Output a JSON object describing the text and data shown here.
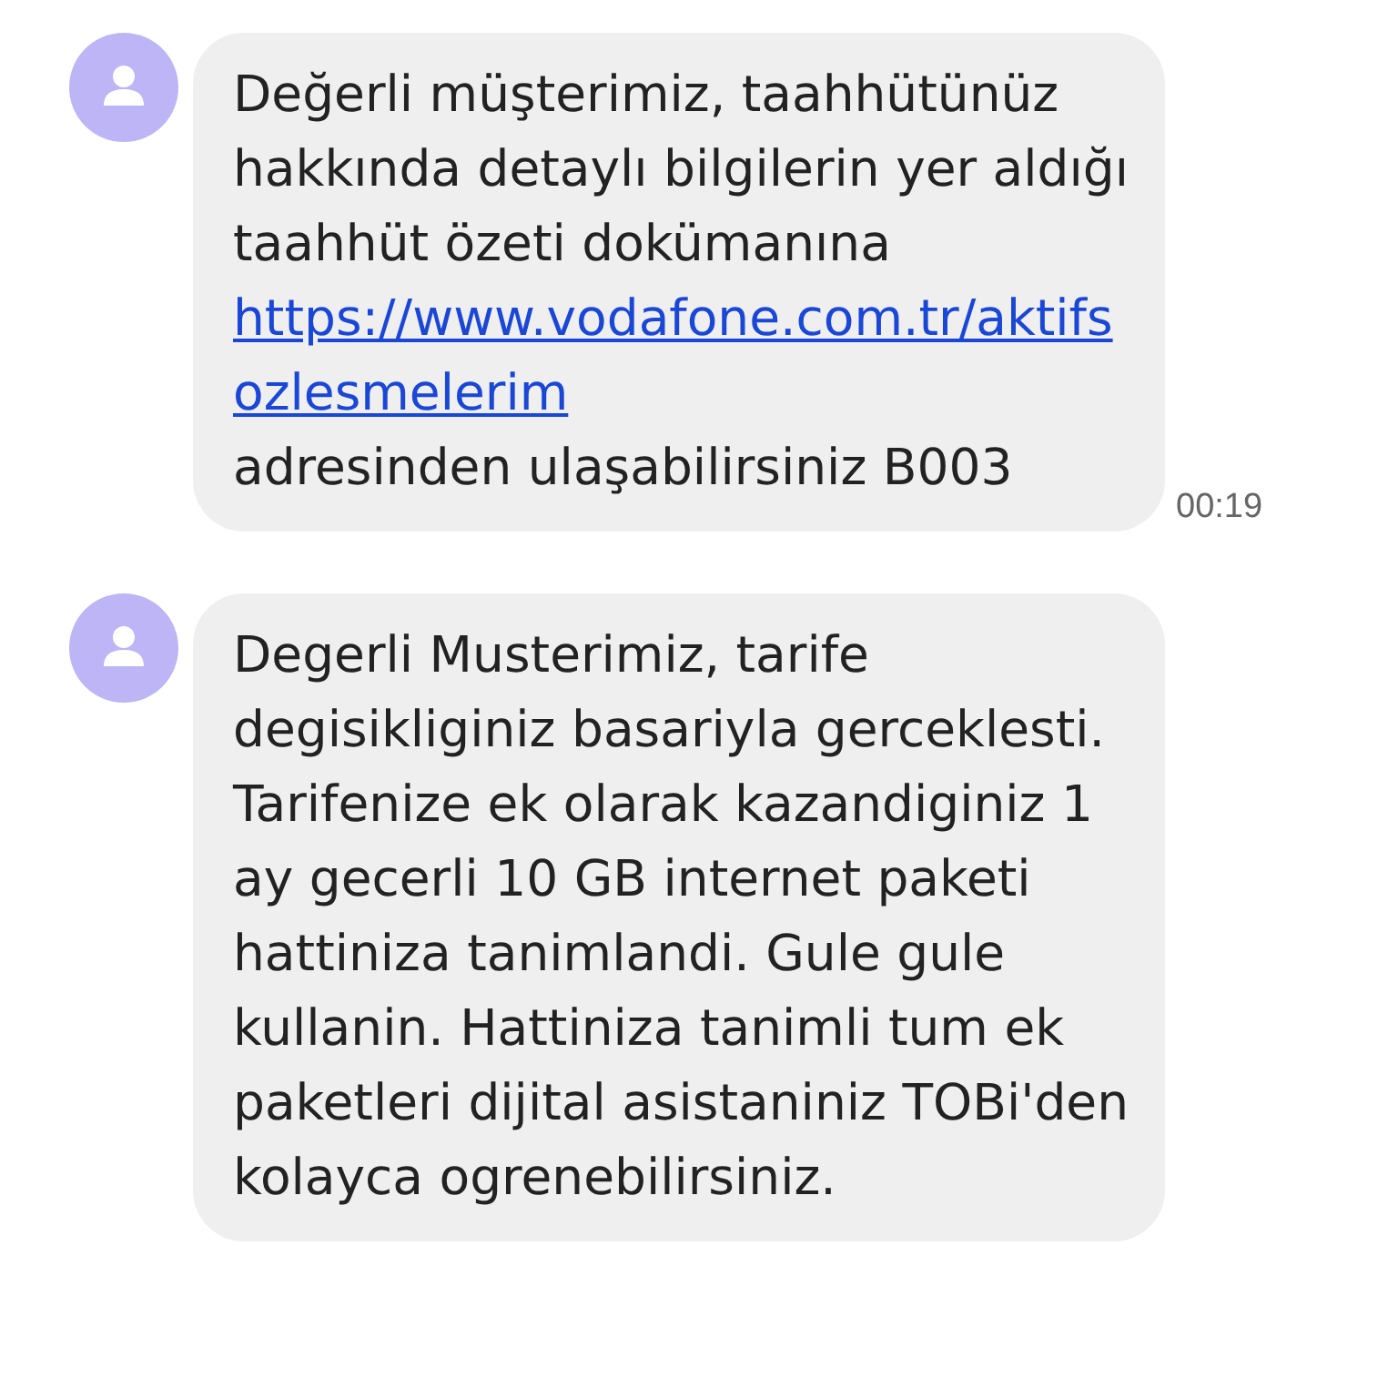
{
  "messages": [
    {
      "parts": [
        {
          "kind": "text",
          "text": "Değerli müşterimiz, taahhütünüz hakkında detaylı bilgilerin yer aldığı taahhüt özeti dokümanına "
        },
        {
          "kind": "link",
          "text": "https://www.vodafone.com.tr/aktifsozlesmelerim"
        },
        {
          "kind": "text",
          "text": " adresinden ulaşabilirsiniz B003"
        }
      ],
      "time": "00:19"
    },
    {
      "parts": [
        {
          "kind": "text",
          "text": "Degerli Musterimiz, tarife degisikliginiz basariyla gerceklesti. Tarifenize ek olarak kazandiginiz 1 ay gecerli 10 GB internet paketi hattiniza tanimlandi. Gule gule kullanin. Hattiniza tanimli tum ek paketleri dijital asistaniniz TOBi'den kolayca ogrenebilirsiniz."
        }
      ]
    }
  ]
}
